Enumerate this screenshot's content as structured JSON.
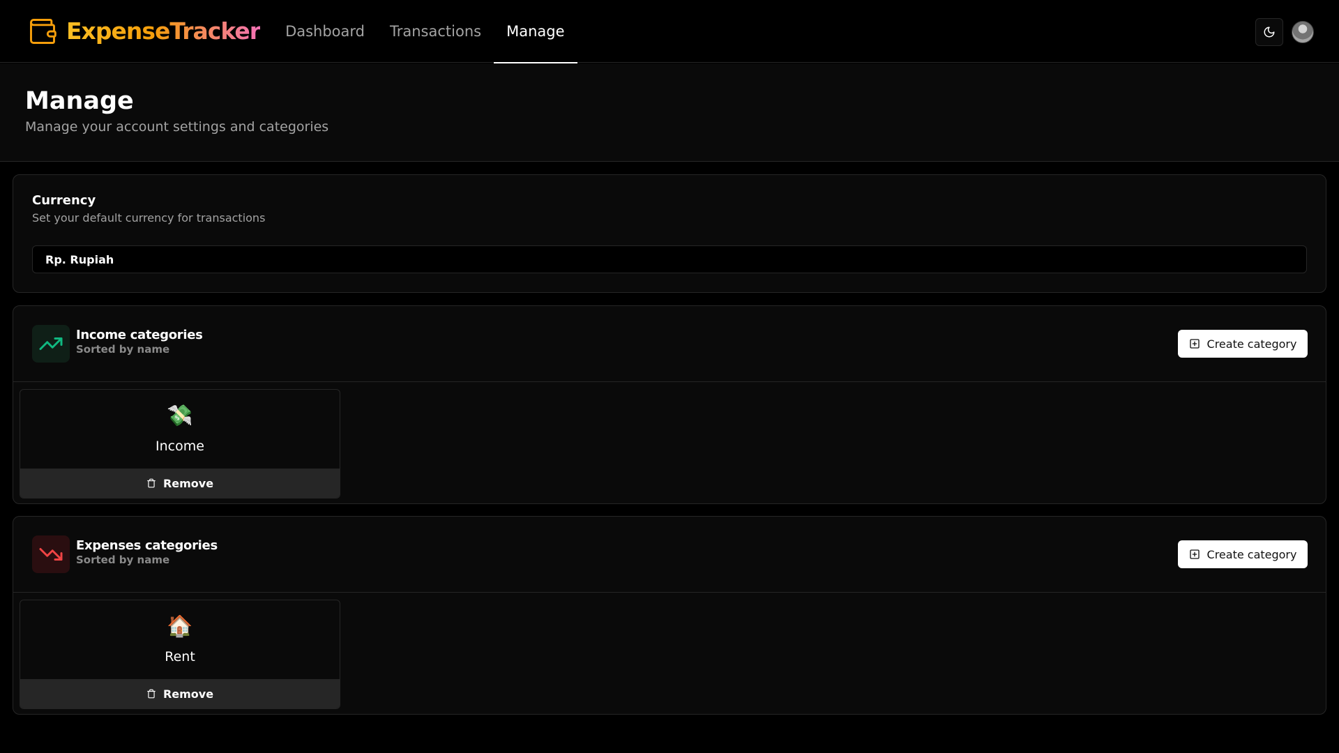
{
  "brand": {
    "name": "ExpenseTracker"
  },
  "nav": {
    "items": [
      {
        "label": "Dashboard",
        "active": false
      },
      {
        "label": "Transactions",
        "active": false
      },
      {
        "label": "Manage",
        "active": true
      }
    ]
  },
  "header": {
    "title": "Manage",
    "subtitle": "Manage your account settings and categories"
  },
  "currency": {
    "title": "Currency",
    "description": "Set your default currency for transactions",
    "selected": "Rp. Rupiah"
  },
  "income": {
    "title": "Income categories",
    "subtitle": "Sorted by name",
    "create_label": "Create category",
    "items": [
      {
        "icon": "💸",
        "name": "Income",
        "remove_label": "Remove"
      }
    ]
  },
  "expenses": {
    "title": "Expenses categories",
    "subtitle": "Sorted by name",
    "create_label": "Create category",
    "items": [
      {
        "icon": "🏠",
        "name": "Rent",
        "remove_label": "Remove"
      }
    ]
  },
  "colors": {
    "income_accent": "#10b981",
    "expense_accent": "#ef4444",
    "brand_gradient_start": "#fbbf24",
    "brand_gradient_end": "#f472b6"
  }
}
